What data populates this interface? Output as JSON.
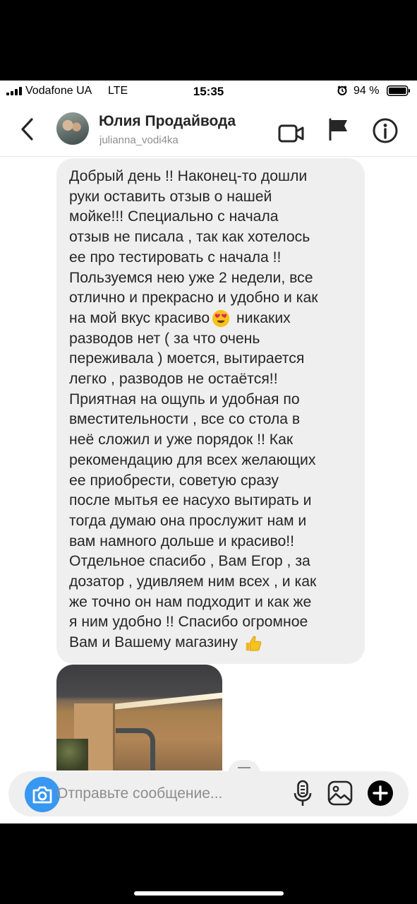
{
  "status_bar": {
    "carrier": "Vodafone UA",
    "network": "LTE",
    "time": "15:35",
    "battery": "94 %"
  },
  "header": {
    "contact_name": "Юлия Продайвода",
    "username": "julianna_vodi4ka",
    "icons": [
      "back-icon",
      "avatar",
      "video-call-icon",
      "flag-icon",
      "info-icon"
    ]
  },
  "message": {
    "lines": [
      "Добрый день !! Наконец-то дошли",
      "руки оставить отзыв о нашей",
      "мойке!!!  Специально с начала",
      "отзыв не писала , так как хотелось",
      "ее про тестировать с начала !!",
      "Пользуемся нею уже 2 недели, все",
      "отлично и прекрасно и удобно и как",
      "на мой вкус красиво",
      "никаких",
      "разводов нет ( за что очень",
      "переживала ) моется, вытирается",
      "легко , разводов не остаётся!!",
      "Приятная на ощупь и удобная по",
      "вместительности , все со стола в",
      "неё сложил и уже порядок !!  Как",
      "рекомендацию для всех желающих",
      "ее приобрести, советую сразу",
      "после мытья ее насухо вытирать и",
      "тогда думаю она прослужит нам и",
      "вам намного дольше и красиво!!",
      "Отдельное спасибо , Вам Егор , за",
      "дозатор , удивляем ним всех , и как",
      "же точно он нам подходит и как же",
      "я ним удобно !! Спасибо огромное",
      "Вам и Вашему магазину"
    ],
    "emojis": [
      "heart-eyes-emoji",
      "thumbs-up-emoji"
    ]
  },
  "composer": {
    "placeholder": "Отправьте сообщение...",
    "icons": [
      "camera-icon",
      "microphone-icon",
      "gallery-icon",
      "add-icon"
    ]
  },
  "colors": {
    "accent": "#3897f0",
    "bubble": "#efefef",
    "secondary_text": "#8e8e8e"
  }
}
